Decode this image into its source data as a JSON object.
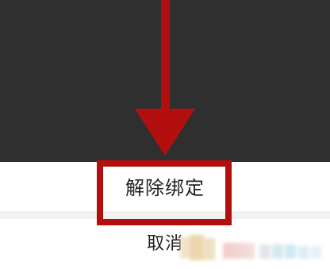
{
  "sheet": {
    "unbind_label": "解除绑定",
    "cancel_label": "取消"
  },
  "annotation": {
    "arrow_color": "#b40f0f",
    "box_color": "#b40f0f"
  }
}
